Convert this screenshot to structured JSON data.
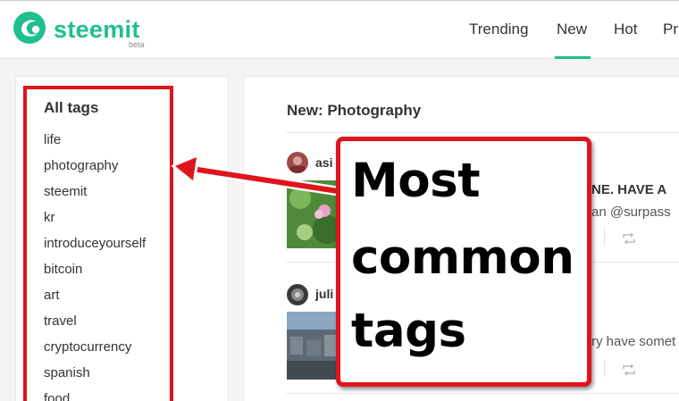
{
  "header": {
    "brand": "steemit",
    "beta": "beta",
    "nav": [
      "Trending",
      "New",
      "Hot",
      "Pr"
    ]
  },
  "sidebar": {
    "title": "All tags",
    "tags": [
      "life",
      "photography",
      "steemit",
      "kr",
      "introduceyourself",
      "bitcoin",
      "art",
      "travel",
      "cryptocurrency",
      "spanish",
      "food"
    ]
  },
  "main": {
    "title": "New: Photography",
    "posts": [
      {
        "author": "asi",
        "title_fragment": "NE. HAVE A",
        "body_fragment": "an @surpass"
      },
      {
        "author": "juli",
        "title_fragment": "",
        "body_fragment": "ry have somet"
      }
    ]
  },
  "callout": {
    "lines": [
      "Most",
      "common",
      "tags"
    ]
  },
  "colors": {
    "brand": "#1fbf8f",
    "annotation": "#e0141c"
  }
}
